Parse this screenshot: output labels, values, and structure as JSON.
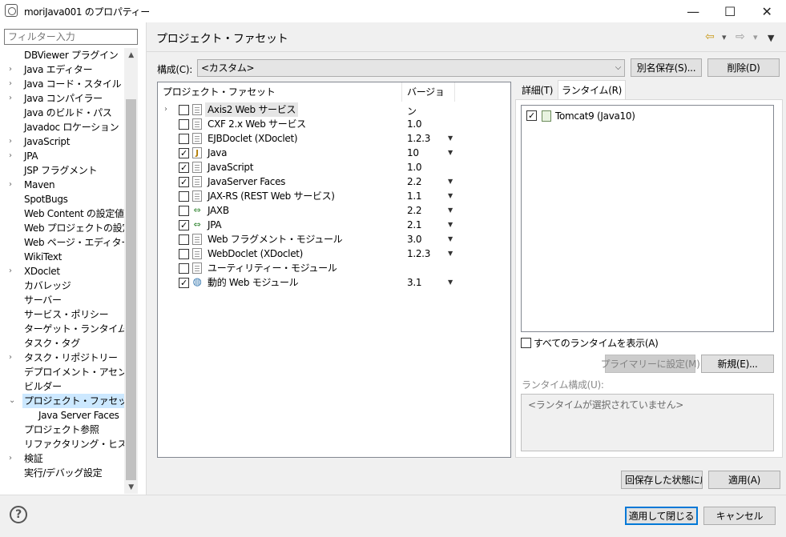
{
  "window": {
    "title": "moriJava001 のプロパティー",
    "minimize": "—",
    "maximize": "☐",
    "close": "✕"
  },
  "filter": {
    "placeholder": "フィルター入力"
  },
  "tree": {
    "items": [
      {
        "label": "DBViewer プラグイン",
        "expand": ""
      },
      {
        "label": "Java エディター",
        "expand": "›"
      },
      {
        "label": "Java コード・スタイル",
        "expand": "›"
      },
      {
        "label": "Java コンパイラー",
        "expand": "›"
      },
      {
        "label": "Java のビルド・パス",
        "expand": ""
      },
      {
        "label": "Javadoc ロケーション",
        "expand": ""
      },
      {
        "label": "JavaScript",
        "expand": "›"
      },
      {
        "label": "JPA",
        "expand": "›"
      },
      {
        "label": "JSP フラグメント",
        "expand": ""
      },
      {
        "label": "Maven",
        "expand": "›"
      },
      {
        "label": "SpotBugs",
        "expand": ""
      },
      {
        "label": "Web Content の設定値",
        "expand": ""
      },
      {
        "label": "Web プロジェクトの設定",
        "expand": ""
      },
      {
        "label": "Web ページ・エディター",
        "expand": ""
      },
      {
        "label": "WikiText",
        "expand": ""
      },
      {
        "label": "XDoclet",
        "expand": "›"
      },
      {
        "label": "カバレッジ",
        "expand": ""
      },
      {
        "label": "サーバー",
        "expand": ""
      },
      {
        "label": "サービス・ポリシー",
        "expand": ""
      },
      {
        "label": "ターゲット・ランタイム",
        "expand": ""
      },
      {
        "label": "タスク・タグ",
        "expand": ""
      },
      {
        "label": "タスク・リポジトリー",
        "expand": "›"
      },
      {
        "label": "デプロイメント・アセンブリー",
        "expand": ""
      },
      {
        "label": "ビルダー",
        "expand": ""
      },
      {
        "label": "プロジェクト・ファセット",
        "expand": "⌄",
        "selected": true
      },
      {
        "label": "Java Server Faces",
        "expand": "",
        "sub": true
      },
      {
        "label": "プロジェクト参照",
        "expand": ""
      },
      {
        "label": "リファクタリング・ヒストリー",
        "expand": ""
      },
      {
        "label": "検証",
        "expand": "›"
      },
      {
        "label": "実行/デバッグ設定",
        "expand": ""
      }
    ],
    "scroll_up": "▲",
    "scroll_down": "▼"
  },
  "page": {
    "title": "プロジェクト・ファセット",
    "nav_back": "⇦",
    "nav_back_menu": "▾",
    "nav_forward": "⇨",
    "nav_forward_menu": "▾",
    "view_menu": "▼"
  },
  "config": {
    "label": "構成(C):",
    "value": "<カスタム>",
    "save_as": "別名保存(S)...",
    "delete": "削除(D)"
  },
  "facets": {
    "col_facet": "プロジェクト・ファセット",
    "col_version": "バージョン",
    "rows": [
      {
        "name": "Axis2 Web サービス",
        "checked": false,
        "version": "",
        "dropdown": false,
        "icon": "doc",
        "expandable": true,
        "highlight": true
      },
      {
        "name": "CXF 2.x Web サービス",
        "checked": false,
        "version": "1.0",
        "dropdown": false,
        "icon": "doc"
      },
      {
        "name": "EJBDoclet (XDoclet)",
        "checked": false,
        "version": "1.2.3",
        "dropdown": true,
        "icon": "doc"
      },
      {
        "name": "Java",
        "checked": true,
        "version": "10",
        "dropdown": true,
        "icon": "java"
      },
      {
        "name": "JavaScript",
        "checked": true,
        "version": "1.0",
        "dropdown": false,
        "icon": "doc"
      },
      {
        "name": "JavaServer Faces",
        "checked": true,
        "version": "2.2",
        "dropdown": true,
        "icon": "doc"
      },
      {
        "name": "JAX-RS (REST Web サービス)",
        "checked": false,
        "version": "1.1",
        "dropdown": true,
        "icon": "doc"
      },
      {
        "name": "JAXB",
        "checked": false,
        "version": "2.2",
        "dropdown": true,
        "icon": "arrows"
      },
      {
        "name": "JPA",
        "checked": true,
        "version": "2.1",
        "dropdown": true,
        "icon": "arrows"
      },
      {
        "name": "Web フラグメント・モジュール",
        "checked": false,
        "version": "3.0",
        "dropdown": true,
        "icon": "doc"
      },
      {
        "name": "WebDoclet (XDoclet)",
        "checked": false,
        "version": "1.2.3",
        "dropdown": true,
        "icon": "doc"
      },
      {
        "name": "ユーティリティー・モジュール",
        "checked": false,
        "version": "",
        "dropdown": false,
        "icon": "doc"
      },
      {
        "name": "動的 Web モジュール",
        "checked": true,
        "version": "3.1",
        "dropdown": true,
        "icon": "globe"
      }
    ]
  },
  "tabs": {
    "details": "詳細(T)",
    "runtimes": "ランタイム(R)"
  },
  "runtimes": {
    "items": [
      {
        "name": "Tomcat9 (Java10)",
        "checked": true
      }
    ],
    "show_all": "すべてのランタイムを表示(A)",
    "make_primary": "プライマリーに設定(M)",
    "new": "新規(E)...",
    "composition_label": "ランタイム構成(U):",
    "composition_placeholder": "<ランタイムが選択されていません>"
  },
  "footer": {
    "restore": "回保存した状態に戻",
    "apply": "適用(A)",
    "apply_close": "適用して閉じる",
    "cancel": "キャンセル",
    "help": "?"
  }
}
